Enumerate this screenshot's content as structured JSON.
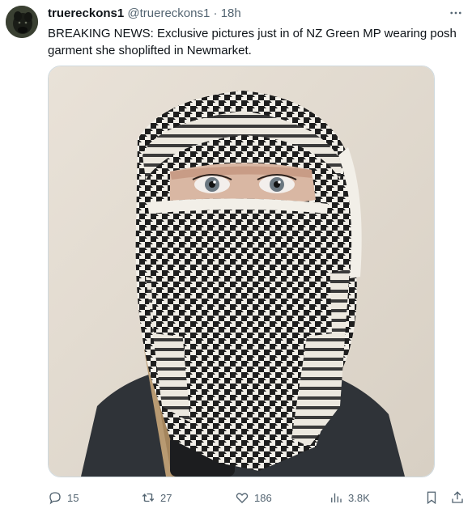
{
  "tweet": {
    "display_name": "truereckons1",
    "handle": "@truereckons1",
    "separator": "·",
    "time": "18h",
    "text": "BREAKING NEWS: Exclusive pictures just in of NZ Green MP wearing posh garment she shoplifted in Newmarket."
  },
  "actions": {
    "replies": "15",
    "retweets": "27",
    "likes": "186",
    "views": "3.8K"
  },
  "icons": {
    "more": "more-horizontal-icon",
    "reply": "reply-icon",
    "retweet": "retweet-icon",
    "like": "heart-icon",
    "views": "views-icon",
    "bookmark": "bookmark-icon",
    "share": "share-icon"
  }
}
